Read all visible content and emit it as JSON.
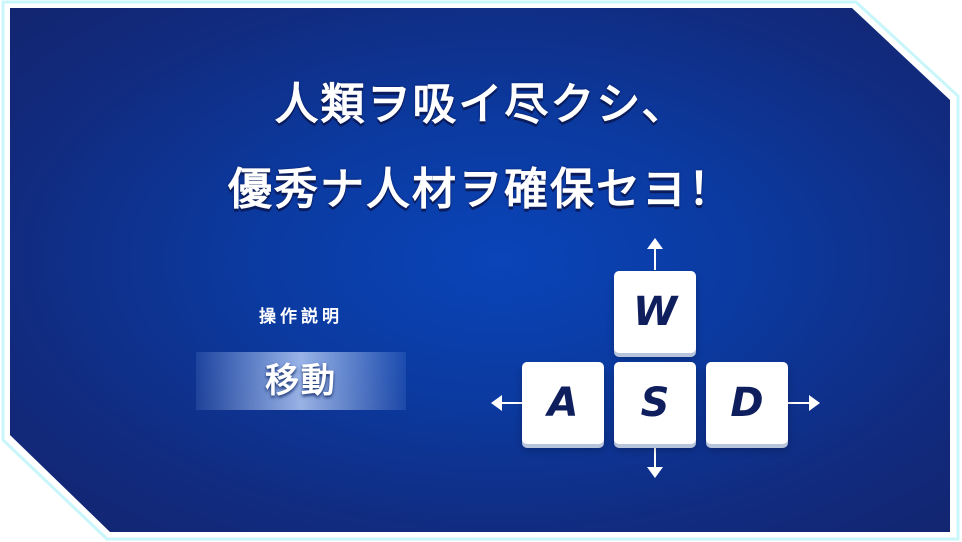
{
  "headline": {
    "line1": "人類ヲ吸イ尽クシ、",
    "line2": "優秀ナ人材ヲ確保セヨ！"
  },
  "controls": {
    "title": "操作説明",
    "move_label": "移動"
  },
  "keys": {
    "up": "W",
    "left": "A",
    "down": "S",
    "right": "D"
  },
  "colors": {
    "panel_center": "#0a44b8",
    "panel_edge": "#13246c",
    "frame_outline": "#c8f6fa",
    "key_background": "#ffffff",
    "key_text": "#0f1f5e"
  }
}
